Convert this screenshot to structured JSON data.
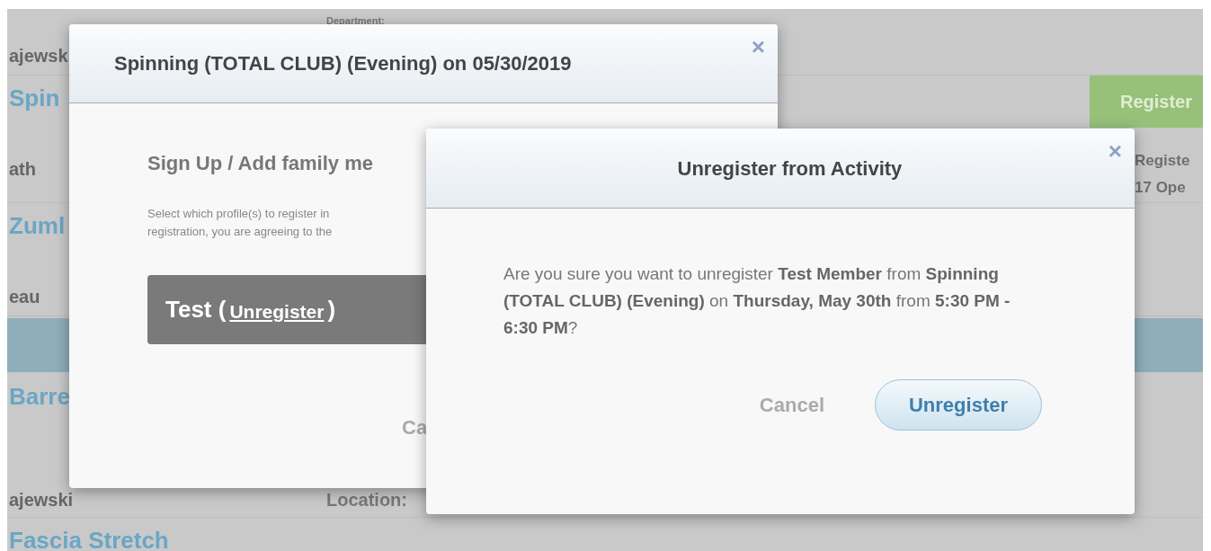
{
  "page": {
    "rows": [
      {
        "kind": "meta",
        "right": "Department:"
      },
      {
        "kind": "meta",
        "left": "ajewsk"
      },
      {
        "kind": "title",
        "text": "Spin",
        "button": "Register"
      },
      {
        "kind": "meta",
        "left": "ath",
        "status": [
          "Registe",
          "17 Ope"
        ]
      },
      {
        "kind": "title",
        "text": "Zuml"
      },
      {
        "kind": "meta",
        "left": "eau"
      },
      {
        "kind": "band"
      },
      {
        "kind": "title",
        "text": "Barre"
      },
      {
        "kind": "meta",
        "left": "ajewski",
        "right": "Location:"
      },
      {
        "kind": "title",
        "text": "Fascia Stretch"
      }
    ]
  },
  "signup_dialog": {
    "title": "Spinning (TOTAL CLUB) (Evening) on 05/30/2019",
    "close": "×",
    "heading": "Sign Up / Add family me",
    "instructions": [
      "Select which profile(s) to register in",
      "registration, you are agreeing to the"
    ],
    "profile": {
      "name": "Test (",
      "link": "Unregister",
      "close_paren": ")"
    },
    "cancel": "Ca"
  },
  "unregister_dialog": {
    "title": "Unregister from Activity",
    "close": "×",
    "message": "Are you sure you want to unregister **Test Member** from **Spinning (TOTAL CLUB) (Evening)** on **Thursday, May 30th** from **5:30 PM - 6:30 PM**?",
    "cancel": "Cancel",
    "confirm": "Unregister"
  }
}
